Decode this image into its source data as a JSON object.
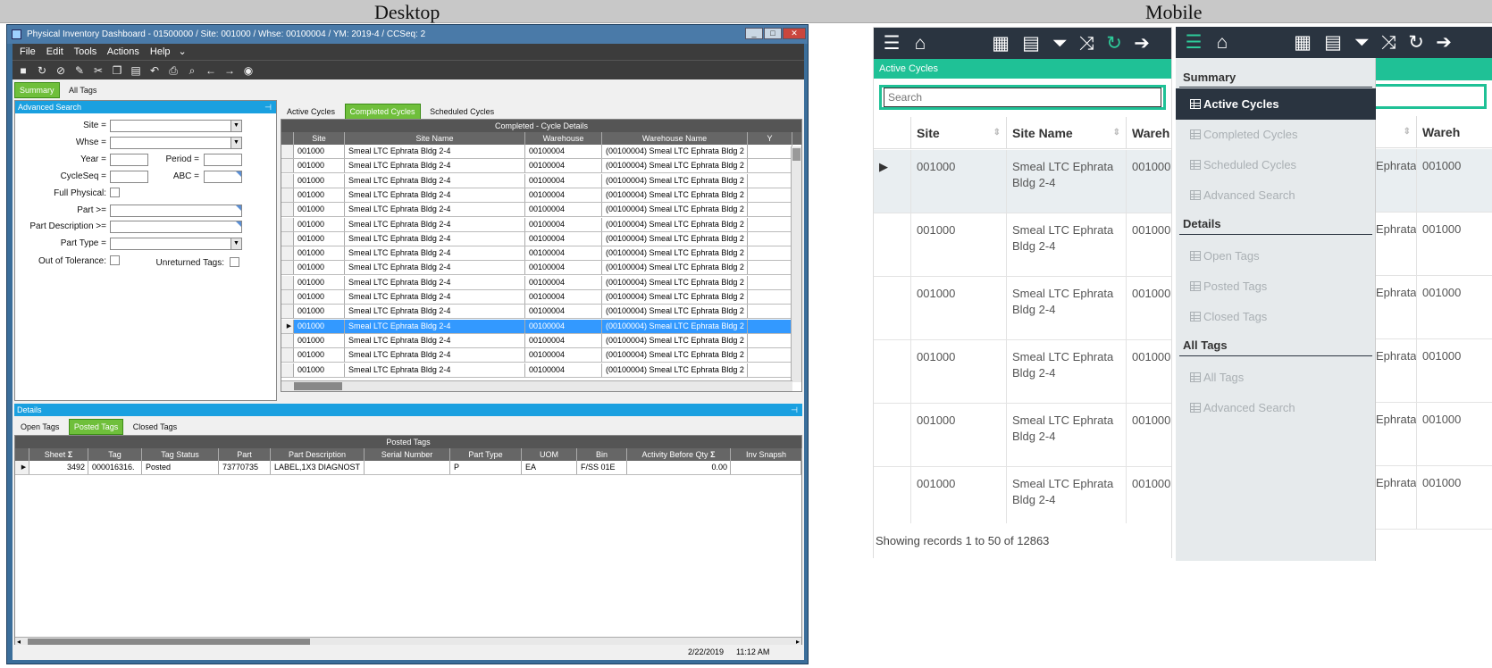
{
  "headers": {
    "desktop": "Desktop",
    "mobile": "Mobile"
  },
  "window": {
    "title": "Physical Inventory Dashboard - 01500000 / Site: 001000 / Whse: 00100004 / YM: 2019-4 / CCSeq: 2"
  },
  "menu": {
    "file": "File",
    "edit": "Edit",
    "tools": "Tools",
    "actions": "Actions",
    "help": "Help"
  },
  "sheet_tabs": {
    "summary": "Summary",
    "all_tags": "All Tags"
  },
  "adv_search": {
    "title": "Advanced Search",
    "site": "Site =",
    "whse": "Whse =",
    "year": "Year =",
    "period": "Period =",
    "cycleseq": "CycleSeq =",
    "abc": "ABC =",
    "full_physical": "Full Physical:",
    "part": "Part >=",
    "part_desc": "Part Description >=",
    "part_type": "Part Type =",
    "out_of_tol": "Out of Tolerance:",
    "unreturned": "Unreturned Tags:"
  },
  "cycle_tabs": {
    "active": "Active Cycles",
    "completed": "Completed Cycles",
    "scheduled": "Scheduled Cycles"
  },
  "cycle_grid": {
    "title": "Completed - Cycle Details",
    "columns": [
      "Site",
      "Site Name",
      "Warehouse",
      "Warehouse Name",
      "Y"
    ],
    "row": {
      "site": "001000",
      "site_name": "Smeal LTC Ephrata Bldg 2-4",
      "warehouse": "00100004",
      "warehouse_name": "(00100004) Smeal LTC Ephrata Bldg 2"
    },
    "row_count": 16,
    "selected_index": 12
  },
  "details": {
    "title": "Details",
    "tabs": {
      "open": "Open Tags",
      "posted": "Posted Tags",
      "closed": "Closed Tags"
    },
    "grid_title": "Posted Tags",
    "columns": [
      "Sheet",
      "Tag",
      "Tag Status",
      "Part",
      "Part Description",
      "Serial Number",
      "Part Type",
      "UOM",
      "Bin",
      "Activity Before Qty",
      "Inv Snapsh"
    ],
    "row": {
      "sheet": "3492",
      "tag": "000016316.",
      "status": "Posted",
      "part": "73770735",
      "desc": "LABEL,1X3 DIAGNOST",
      "serial": "",
      "ptype": "P",
      "uom": "EA",
      "bin": "F/SS 01E",
      "qty": "0.00"
    }
  },
  "status": {
    "date": "2/22/2019",
    "time": "11:12 AM"
  },
  "mobile": {
    "active_label": "Active Cycles",
    "search_placeholder": "Search",
    "columns": {
      "site": "Site",
      "site_name": "Site Name",
      "warehouse": "Wareh"
    },
    "row": {
      "site": "001000",
      "site_name": "Smeal LTC Ephrata Bldg 2-4",
      "warehouse": "001000"
    },
    "footer": "Showing records 1 to 50 of 12863",
    "drawer": {
      "summary": "Summary",
      "summary_items": [
        "Active Cycles",
        "Completed Cycles",
        "Scheduled Cycles",
        "Advanced Search"
      ],
      "details": "Details",
      "details_items": [
        "Open Tags",
        "Posted Tags",
        "Closed Tags"
      ],
      "all_tags": "All Tags",
      "all_tags_items": [
        "All Tags",
        "Advanced Search"
      ]
    },
    "behind": {
      "col_name": "Ephrata",
      "col_wh": "001000",
      "col_head_wh": "Wareh"
    }
  },
  "colors": {
    "accent_green": "#6fbf3b",
    "panel_blue": "#1aa0e0",
    "selection_blue": "#3399ff",
    "mobile_teal": "#1fc196",
    "mobile_dark": "#2a3440"
  }
}
